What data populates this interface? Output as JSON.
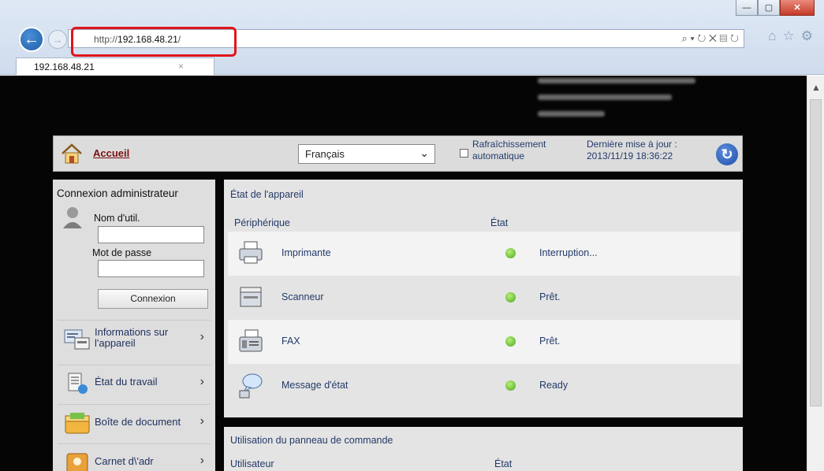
{
  "browser": {
    "url_prefix": "http://",
    "url_host": "192.168.48.21",
    "url_suffix": "/",
    "tab_title": "192.168.48.21",
    "address_icons": "⌕ ▾ ↻ ✕ ▤ ↻",
    "window_buttons": [
      "—",
      "▢",
      "✕"
    ]
  },
  "header": {
    "home_label": "Accueil",
    "language": "Français",
    "auto_refresh_label": "Rafraîchissement automatique",
    "last_update_label": "Dernière mise à jour :",
    "last_update_value": "2013/11/19 18:36:22"
  },
  "login": {
    "title": "Connexion administrateur",
    "username_label": "Nom d'util.",
    "password_label": "Mot de passe",
    "connect_button": "Connexion"
  },
  "sidebar": {
    "items": [
      {
        "label": "Informations sur l'appareil",
        "icon": "device-info-icon"
      },
      {
        "label": "État du travail",
        "icon": "job-status-icon"
      },
      {
        "label": "Boîte de document",
        "icon": "document-box-icon"
      },
      {
        "label": "Carnet d\\'adr",
        "icon": "address-book-icon"
      }
    ]
  },
  "device_status": {
    "title": "État de l'appareil",
    "col_device": "Périphérique",
    "col_state": "État",
    "rows": [
      {
        "name": "Imprimante",
        "state": "Interruption...",
        "status_color": "#5fbf2a",
        "icon": "printer-icon"
      },
      {
        "name": "Scanneur",
        "state": "Prêt.",
        "status_color": "#5fbf2a",
        "icon": "scanner-icon"
      },
      {
        "name": "FAX",
        "state": "Prêt.",
        "status_color": "#5fbf2a",
        "icon": "fax-icon"
      },
      {
        "name": "Message d'état",
        "state": "Ready",
        "status_color": "#5fbf2a",
        "icon": "status-message-icon"
      }
    ]
  },
  "panel_usage": {
    "title": "Utilisation du panneau de commande",
    "col_user": "Utilisateur",
    "col_state": "État"
  },
  "colors": {
    "accent": "#e0151b",
    "link": "#7a1010",
    "text_blue": "#233a6a",
    "status_green": "#5fbf2a"
  }
}
